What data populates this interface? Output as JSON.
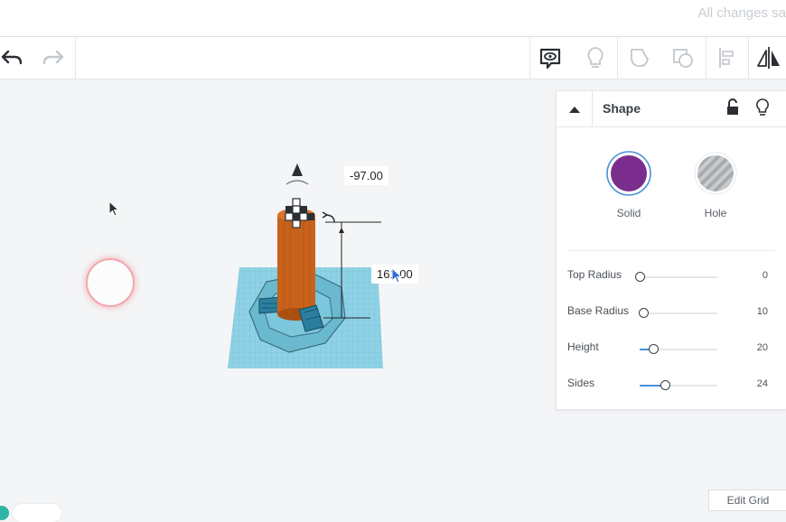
{
  "header": {
    "status": "All changes sa"
  },
  "toolbar": {
    "buttons": [
      {
        "name": "undo-button",
        "icon": "undo-arrow-icon"
      },
      {
        "name": "redo-button",
        "icon": "redo-arrow-icon"
      },
      {
        "name": "notes-button",
        "icon": "note-eye-icon"
      },
      {
        "name": "show-hide-button",
        "icon": "lightbulb-icon"
      },
      {
        "name": "group-button",
        "icon": "group-shape-icon"
      },
      {
        "name": "ungroup-button",
        "icon": "ungroup-shape-icon"
      },
      {
        "name": "align-button",
        "icon": "align-icon"
      },
      {
        "name": "mirror-button",
        "icon": "mirror-icon"
      }
    ]
  },
  "workplane": {
    "dimension_top": "-97.00",
    "dimension_height": "161.00",
    "colors": {
      "grid": "#8fd2e6",
      "shape": "#c8621a",
      "part": "#2a7fa0"
    }
  },
  "panel": {
    "title": "Shape",
    "solid_label": "Solid",
    "hole_label": "Hole",
    "solid_color": "#7b2d8e",
    "properties": [
      {
        "label": "Top Radius",
        "value": "0",
        "level": 0.0
      },
      {
        "label": "Base Radius",
        "value": "10",
        "level": 0.05
      },
      {
        "label": "Height",
        "value": "20",
        "level": 0.18
      },
      {
        "label": "Sides",
        "value": "24",
        "level": 0.33
      }
    ]
  },
  "edit_grid_label": "Edit Grid"
}
